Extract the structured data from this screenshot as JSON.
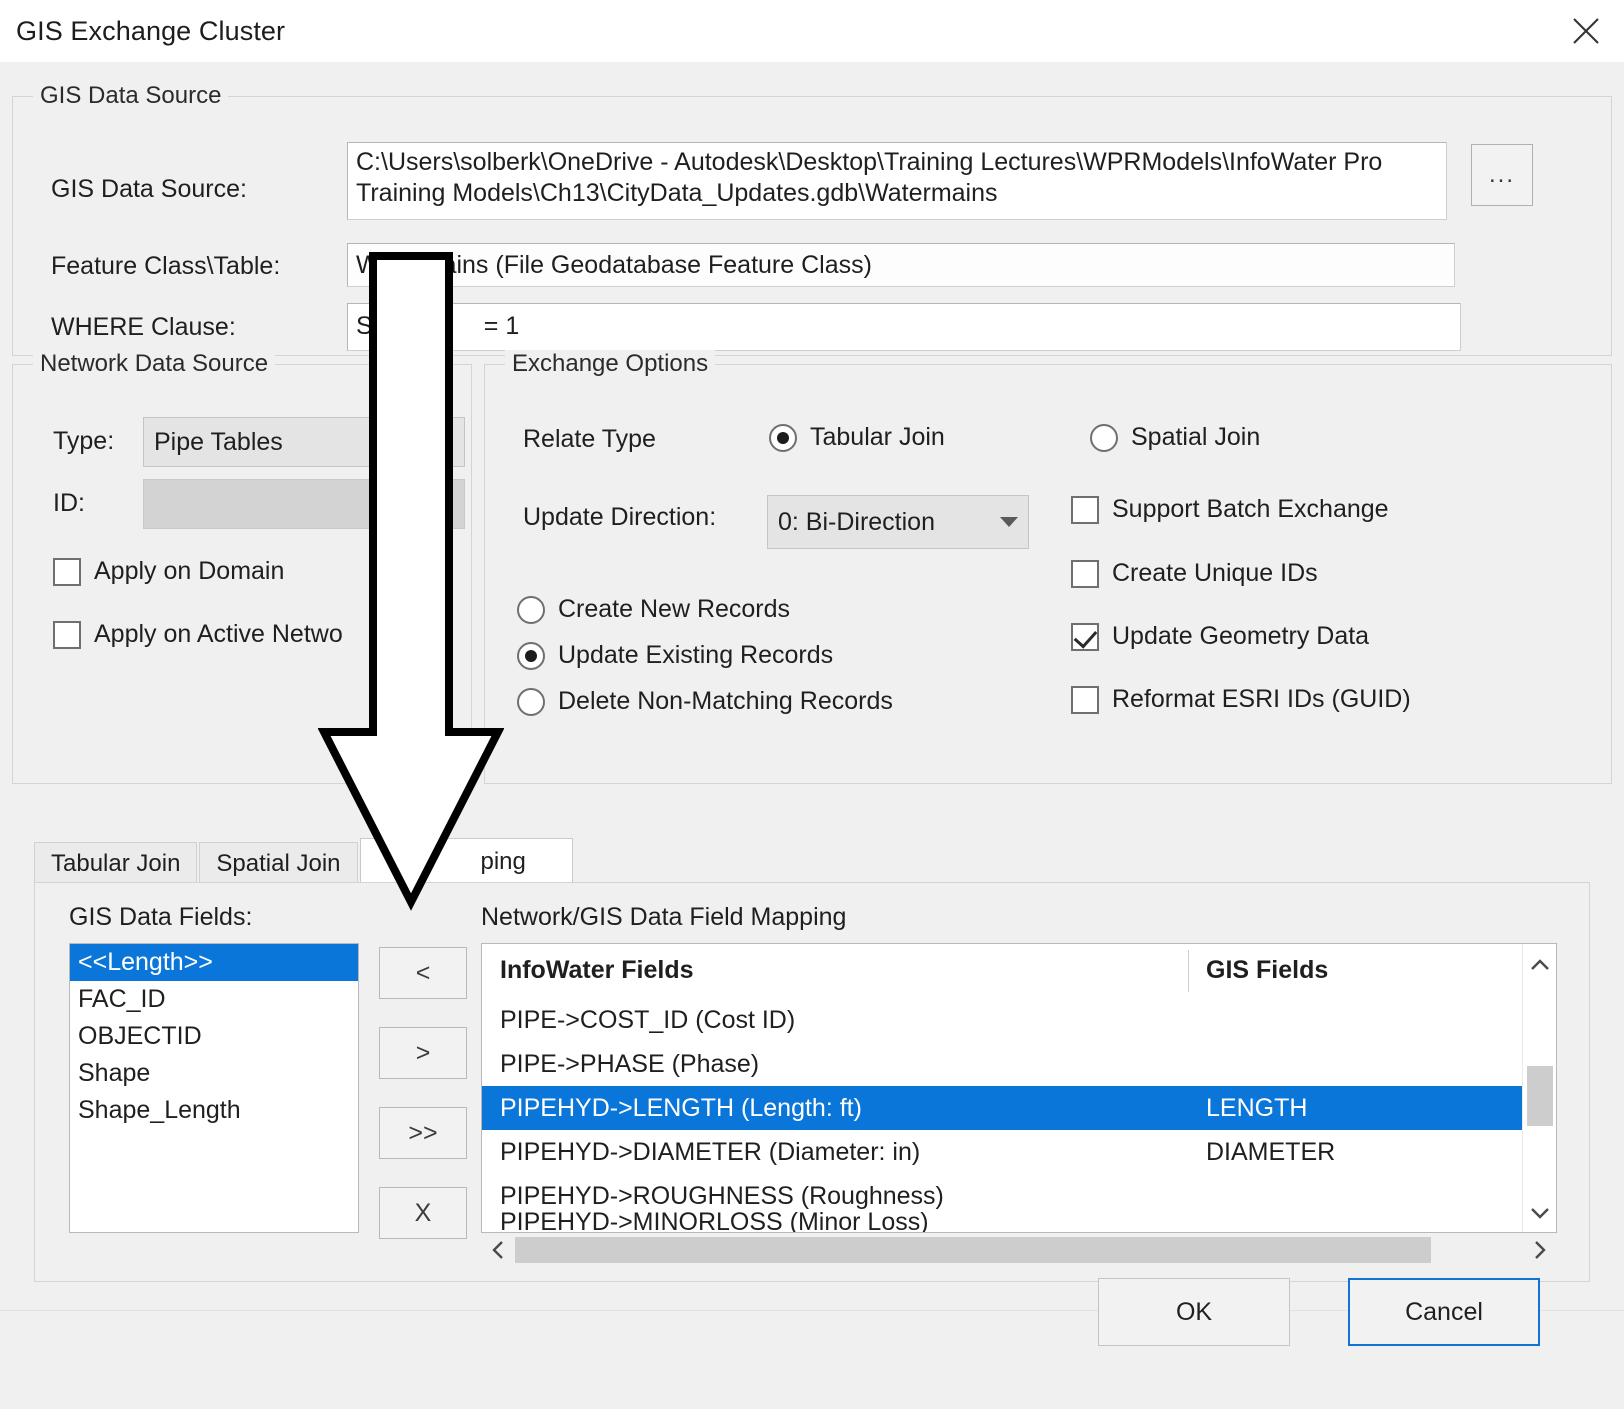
{
  "window": {
    "title": "GIS Exchange Cluster",
    "close_icon": "close-icon"
  },
  "gis_data_source": {
    "legend": "GIS Data Source",
    "source_label": "GIS Data Source:",
    "source_value": "C:\\Users\\solberk\\OneDrive - Autodesk\\Desktop\\Training Lectures\\WPRModels\\InfoWater Pro Training Models\\Ch13\\CityData_Updates.gdb\\Watermains",
    "browse_label": "...",
    "feature_class_label": "Feature Class\\Table:",
    "feature_class_value": "Watermains (File Geodatabase Feature Class)",
    "where_label": "WHERE Clause:",
    "where_value": "S                = 1"
  },
  "network_data_source": {
    "legend": "Network Data Source",
    "type_label": "Type:",
    "type_value": "Pipe Tables",
    "id_label": "ID:",
    "id_value": "",
    "apply_on_domain_label": "Apply on Domain",
    "apply_on_domain_checked": false,
    "apply_on_active_network_label": "Apply on Active Netwo",
    "apply_on_active_network_checked": false
  },
  "exchange_options": {
    "legend": "Exchange Options",
    "relate_type_label": "Relate Type",
    "tabular_join_label": "Tabular Join",
    "tabular_join_selected": true,
    "spatial_join_label": "Spatial Join",
    "spatial_join_selected": false,
    "update_direction_label": "Update Direction:",
    "update_direction_value": "0: Bi-Direction",
    "record_mode": [
      {
        "label": "Create New Records",
        "selected": false
      },
      {
        "label": "Update Existing Records",
        "selected": true
      },
      {
        "label": "Delete Non-Matching Records",
        "selected": false
      }
    ],
    "checkboxes": [
      {
        "label": "Support Batch Exchange",
        "checked": false
      },
      {
        "label": "Create Unique IDs",
        "checked": false
      },
      {
        "label": "Update Geometry Data",
        "checked": true
      },
      {
        "label": "Reformat ESRI IDs (GUID)",
        "checked": false
      }
    ]
  },
  "tabs": [
    {
      "label": "Tabular Join",
      "active": false
    },
    {
      "label": "Spatial Join",
      "active": false
    },
    {
      "label": "ping",
      "active": true
    }
  ],
  "mapping_panel": {
    "gis_fields_label": "GIS Data Fields:",
    "gis_fields": [
      {
        "label": "<<Length>>",
        "selected": true
      },
      {
        "label": "FAC_ID",
        "selected": false
      },
      {
        "label": "OBJECTID",
        "selected": false
      },
      {
        "label": "Shape",
        "selected": false
      },
      {
        "label": "Shape_Length",
        "selected": false
      }
    ],
    "transfer_buttons": [
      {
        "label": "<",
        "name": "move-left-button"
      },
      {
        "label": ">",
        "name": "move-right-button"
      },
      {
        "label": ">>",
        "name": "move-all-right-button"
      },
      {
        "label": "X",
        "name": "clear-button"
      }
    ],
    "mapping_title": "Network/GIS Data Field Mapping",
    "columns": [
      "InfoWater Fields",
      "GIS Fields"
    ],
    "rows": [
      {
        "infowater": "PIPE->COST_ID (Cost ID)",
        "gis": "",
        "selected": false
      },
      {
        "infowater": "PIPE->PHASE (Phase)",
        "gis": "",
        "selected": false
      },
      {
        "infowater": "PIPEHYD->LENGTH (Length: ft)",
        "gis": "LENGTH",
        "selected": true
      },
      {
        "infowater": "PIPEHYD->DIAMETER (Diameter: in)",
        "gis": "DIAMETER",
        "selected": false
      },
      {
        "infowater": "PIPEHYD->ROUGHNESS (Roughness)",
        "gis": "",
        "selected": false
      },
      {
        "infowater": "PIPEHYD->MINORLOSS (Minor Loss)",
        "gis": "",
        "selected": false
      }
    ],
    "scroll_up_icon": "chevron-up-icon",
    "scroll_down_icon": "chevron-down-icon",
    "scroll_left_icon": "chevron-left-icon",
    "scroll_right_icon": "chevron-right-icon"
  },
  "footer": {
    "ok_label": "OK",
    "cancel_label": "Cancel"
  },
  "annotation": {
    "arrow_icon": "down-arrow-annotation"
  },
  "colors": {
    "selection_blue": "#0b76d9",
    "focus_border_blue": "#1273d4",
    "dialog_bg": "#f0f0f0",
    "field_bg": "#ffffff"
  }
}
